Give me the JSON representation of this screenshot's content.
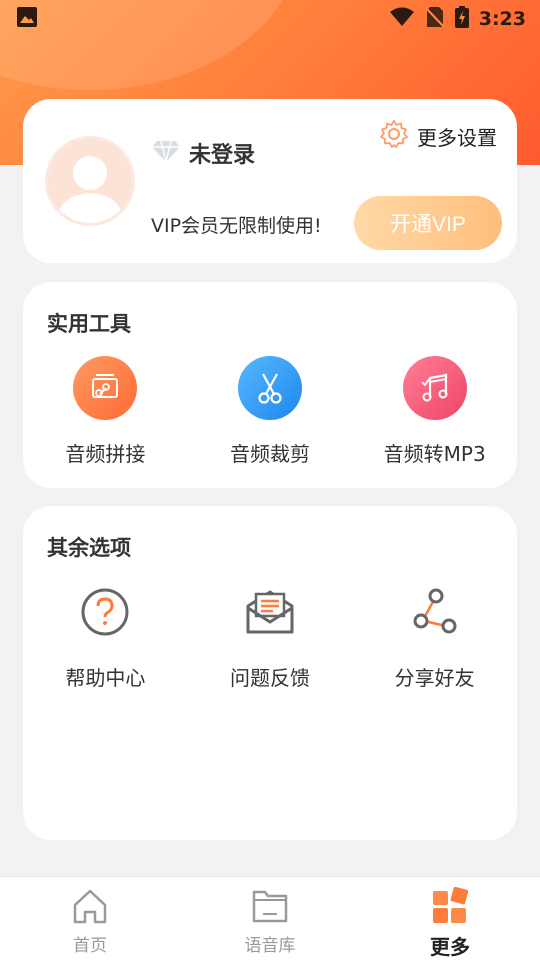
{
  "status_bar": {
    "time": "3:23"
  },
  "profile": {
    "login_status": "未登录",
    "settings_label": "更多设置",
    "vip_description": "VIP会员无限制使用!",
    "vip_button": "开通VIP"
  },
  "tools": {
    "title": "实用工具",
    "items": [
      {
        "label": "音频拼接",
        "icon": "link-icon",
        "color": "#ff7e47"
      },
      {
        "label": "音频裁剪",
        "icon": "scissors-icon",
        "color": "#2f9bf5"
      },
      {
        "label": "音频转MP3",
        "icon": "music-note-icon",
        "color": "#f25c7a"
      }
    ]
  },
  "others": {
    "title": "其余选项",
    "items": [
      {
        "label": "帮助中心",
        "icon": "help-icon"
      },
      {
        "label": "问题反馈",
        "icon": "feedback-mail-icon"
      },
      {
        "label": "分享好友",
        "icon": "share-icon"
      }
    ]
  },
  "bottom_nav": {
    "tabs": [
      {
        "label": "首页",
        "icon": "home-icon",
        "active": false
      },
      {
        "label": "语音库",
        "icon": "folder-icon",
        "active": false
      },
      {
        "label": "更多",
        "icon": "more-grid-icon",
        "active": true
      }
    ]
  },
  "colors": {
    "accent": "#ff7b3a",
    "vip_gradient_start": "#ffd9a8",
    "vip_gradient_end": "#ffbe7a"
  }
}
